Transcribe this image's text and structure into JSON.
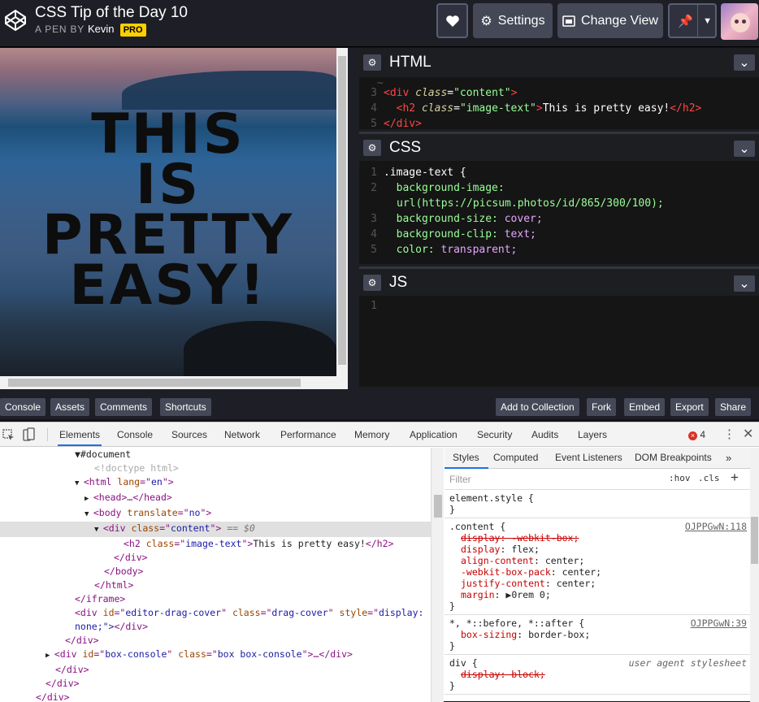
{
  "header": {
    "title": "CSS Tip of the Day 10",
    "by_label": "A PEN BY",
    "author": "Kevin",
    "badge": "PRO",
    "settings_label": "Settings",
    "change_view_label": "Change View"
  },
  "preview": {
    "lines": [
      "THIS",
      "IS",
      "PRETTY",
      "EASY!"
    ]
  },
  "editors": {
    "html": {
      "title": "HTML",
      "lines": [
        {
          "n": "3",
          "tag_open": "<div ",
          "attr": "class",
          "eq": "=",
          "str": "\"content\"",
          "close": ">"
        },
        {
          "n": "4",
          "indent": "  ",
          "tag_open": "<h2 ",
          "attr": "class",
          "eq": "=",
          "str": "\"image-text\"",
          "close": ">",
          "text": "This is pretty easy!",
          "end": "</h2>"
        },
        {
          "n": "5",
          "end": "</div>"
        }
      ]
    },
    "css": {
      "title": "CSS",
      "lines": [
        {
          "n": "1",
          "sel": ".image-text {"
        },
        {
          "n": "2",
          "prop": "  background-image:"
        },
        {
          "n": "",
          "text": "url(https://picsum.photos/id/865/300/100);"
        },
        {
          "n": "3",
          "prop": "  background-size: ",
          "val": "cover;"
        },
        {
          "n": "4",
          "prop": "  background-clip: ",
          "val": "text;"
        },
        {
          "n": "5",
          "prop": "  color: ",
          "val": "transparent;"
        }
      ]
    },
    "js": {
      "title": "JS",
      "lines": [
        {
          "n": "1"
        }
      ]
    }
  },
  "bottom_bar": {
    "left": [
      "Console",
      "Assets",
      "Comments",
      "Shortcuts"
    ],
    "right": [
      "Add to Collection",
      "Fork",
      "Embed",
      "Export",
      "Share"
    ]
  },
  "devtools": {
    "tabs": [
      "Elements",
      "Console",
      "Sources",
      "Network",
      "Performance",
      "Memory",
      "Application",
      "Security",
      "Audits",
      "Layers"
    ],
    "error_count": "4",
    "dom_lines": [
      {
        "indent": 92,
        "html": "▼#document",
        "kind": "tx"
      },
      {
        "indent": 116,
        "html": "<!doctype html>",
        "kind": "c"
      },
      {
        "indent": 104,
        "tri": "▼",
        "tag": "html",
        "attrs": [
          [
            "lang",
            "en"
          ]
        ]
      },
      {
        "indent": 116,
        "tri": "▶",
        "tag": "head",
        "tail": "…</head>"
      },
      {
        "indent": 116,
        "tri": "▼",
        "tag": "body",
        "attrs": [
          [
            "translate",
            "no"
          ]
        ]
      },
      {
        "indent": 128,
        "tri": "▼",
        "tag": "div",
        "attrs": [
          [
            "class",
            "content"
          ]
        ],
        "suffix": " == $0",
        "selected": true
      },
      {
        "indent": 152,
        "tag": "h2",
        "attrs": [
          [
            "class",
            "image-text"
          ]
        ],
        "text": "This is pretty easy!",
        "tail": "</h2>"
      },
      {
        "indent": 140,
        "close": "</div>"
      },
      {
        "indent": 128,
        "close": "</body>"
      },
      {
        "indent": 116,
        "close": "</html>"
      },
      {
        "indent": 92,
        "close": "</iframe>"
      },
      {
        "indent": 92,
        "tag": "div",
        "attrs": [
          [
            "id",
            "editor-drag-cover"
          ],
          [
            "class",
            "drag-cover"
          ],
          [
            "style",
            "display:"
          ]
        ]
      },
      {
        "indent": 92,
        "wrap": "none;\">",
        "close": "</div>"
      },
      {
        "indent": 80,
        "close": "</div>"
      },
      {
        "indent": 68,
        "tri": "▶",
        "tag": "div",
        "attrs": [
          [
            "id",
            "box-console"
          ],
          [
            "class",
            "box box-console"
          ]
        ],
        "tail": "…</div>"
      },
      {
        "indent": 68,
        "close": "</div>"
      },
      {
        "indent": 56,
        "close": "</div>"
      },
      {
        "indent": 44,
        "close": "</div>"
      },
      {
        "indent": 32,
        "close": "</div>"
      }
    ],
    "styles_tabs": [
      "Styles",
      "Computed",
      "Event Listeners",
      "DOM Breakpoints"
    ],
    "filter_placeholder": "Filter",
    "hov_label": ":hov",
    "cls_label": ".cls",
    "rules": [
      {
        "selector": "element.style {",
        "decls": [],
        "close": "}"
      },
      {
        "selector": ".content {",
        "source": "OJPPGwN:118",
        "decls": [
          {
            "p": "display",
            "v": "-webkit-box;",
            "strike": true
          },
          {
            "p": "display",
            "v": "flex;"
          },
          {
            "p": "align-content",
            "v": "center;"
          },
          {
            "p": "-webkit-box-pack",
            "v": "center;"
          },
          {
            "p": "justify-content",
            "v": "center;"
          },
          {
            "p": "margin",
            "v": "▶0rem 0;"
          }
        ],
        "close": "}"
      },
      {
        "selector": "*, *::before, *::after {",
        "source": "OJPPGwN:39",
        "decls": [
          {
            "p": "box-sizing",
            "v": "border-box;"
          }
        ],
        "close": "}"
      },
      {
        "selector": "div {",
        "ua": "user agent stylesheet",
        "decls": [
          {
            "p": "display",
            "v": "block;",
            "strike": true
          }
        ],
        "close": "}"
      }
    ]
  }
}
